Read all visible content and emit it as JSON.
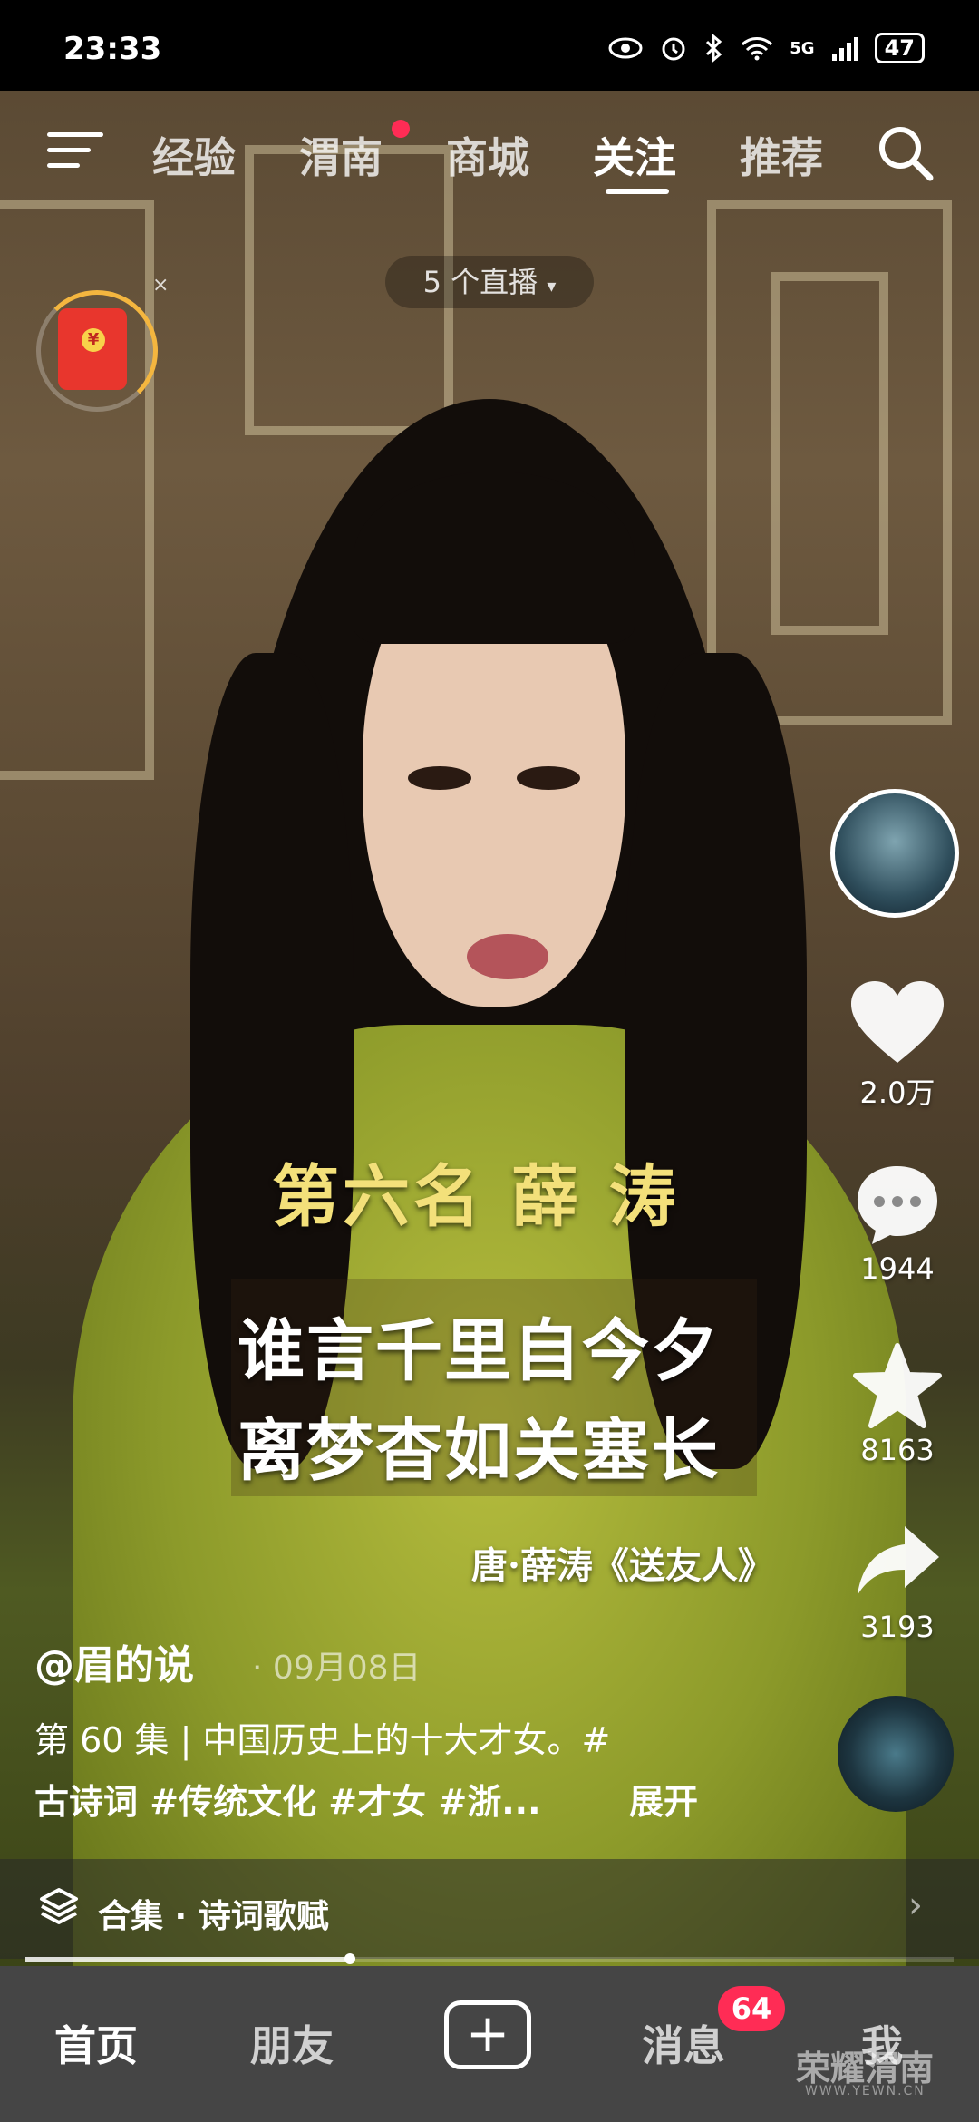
{
  "status_bar": {
    "time": "23:33",
    "network": "5G",
    "battery": "47",
    "icons": [
      "eye-icon",
      "alarm-icon",
      "bluetooth-icon",
      "wifi-icon",
      "signal-icon",
      "battery-icon"
    ]
  },
  "top_nav": {
    "tabs": [
      {
        "label": "经验"
      },
      {
        "label": "渭南"
      },
      {
        "label": "商城"
      },
      {
        "label": "关注"
      },
      {
        "label": "推荐"
      }
    ],
    "active_tab": "关注",
    "red_dot_on": "渭南",
    "live_pill": "5 个直播"
  },
  "red_packet": {
    "close": "×",
    "coin": "¥"
  },
  "subtitles": {
    "rank_title": "第六名  薛  涛",
    "poem_line1": "谁言千里自今夕",
    "poem_line2": "离梦杳如关塞长",
    "source": "唐·薛涛《送友人》"
  },
  "right_rail": {
    "avatar_plus": "+",
    "likes": "2.0万",
    "comments": "1944",
    "favorites": "8163",
    "shares": "3193"
  },
  "caption": {
    "author": "@眉的说",
    "date": "· 09月08日",
    "line1": "第 60 集 | 中国历史上的十大才女。#",
    "line2": "古诗词 #传统文化 #才女 #浙...",
    "expand": "展开"
  },
  "collection": {
    "label": "合集 · 诗词歌赋",
    "chevron": "›"
  },
  "progress": {
    "fraction": 0.35
  },
  "bottom_nav": {
    "home": "首页",
    "friends": "朋友",
    "create": "+",
    "messages": "消息",
    "messages_badge": "64",
    "me": "我"
  },
  "watermark": {
    "text": "荣耀渭南",
    "url": "WWW.YEWN.CN"
  },
  "colors": {
    "accent_red": "#ff2c55",
    "subtitle_gold": "#f3e07a"
  }
}
